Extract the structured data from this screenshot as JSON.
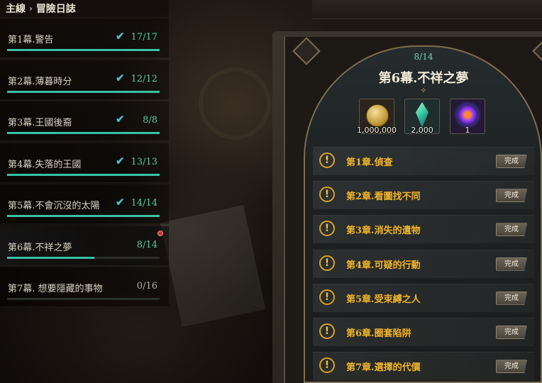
{
  "header": {
    "main": "主線",
    "separator": "›",
    "sub": "冒險日誌"
  },
  "acts": [
    {
      "title": "第1幕.警告",
      "count": "17/17",
      "progress": 1.0,
      "completed": true
    },
    {
      "title": "第2幕.薄暮時分",
      "count": "12/12",
      "progress": 1.0,
      "completed": true
    },
    {
      "title": "第3幕.王國後裔",
      "count": "8/8",
      "progress": 1.0,
      "completed": true
    },
    {
      "title": "第4幕.失落的王國",
      "count": "13/13",
      "progress": 1.0,
      "completed": true
    },
    {
      "title": "第5幕.不會沉沒的太陽",
      "count": "14/14",
      "progress": 1.0,
      "completed": true
    },
    {
      "title": "第6幕.不祥之夢",
      "count": "8/14",
      "progress": 0.57,
      "completed": false,
      "notification": true
    },
    {
      "title": "第7幕. 想要隱藏的事物",
      "count": "0/16",
      "progress": 0.0,
      "completed": false
    }
  ],
  "detail": {
    "progress": "8/14",
    "title": "第6幕.不祥之夢",
    "rewards": [
      {
        "icon": "gold-coin-icon",
        "qty": "1,000,000"
      },
      {
        "icon": "green-crystal-icon",
        "qty": "2,000"
      },
      {
        "icon": "purple-orb-icon",
        "qty": "1"
      }
    ],
    "chapters": [
      {
        "title": "第1章.偵查",
        "button": "完成"
      },
      {
        "title": "第2章.看圖找不同",
        "button": "完成"
      },
      {
        "title": "第3章.消失的遺物",
        "button": "完成"
      },
      {
        "title": "第4章.可疑的行動",
        "button": "完成"
      },
      {
        "title": "第5章.受束縛之人",
        "button": "完成"
      },
      {
        "title": "第6章.圈套陷阱",
        "button": "完成"
      },
      {
        "title": "第7章.選擇的代價",
        "button": "完成"
      }
    ],
    "chapter_mark": "!"
  },
  "colors": {
    "accent_teal": "#39c1a2",
    "chapter_gold": "#f0b52a",
    "check": "#4fb9c6"
  }
}
